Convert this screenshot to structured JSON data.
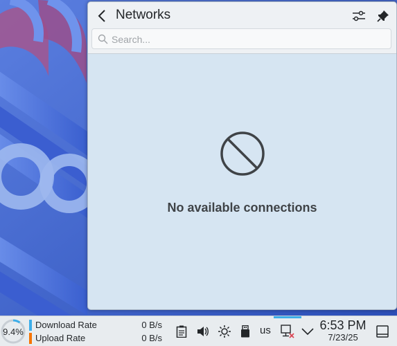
{
  "popup": {
    "title": "Networks",
    "search_placeholder": "Search...",
    "empty_message": "No available connections"
  },
  "taskbar": {
    "cpu_load": "9.4%",
    "download_label": "Download Rate",
    "download_value": "0 B/s",
    "upload_label": "Upload Rate",
    "upload_value": "0 B/s",
    "keyboard_layout": "us",
    "clock_time": "6:53 PM",
    "clock_date": "7/23/25"
  },
  "colors": {
    "download_bar": "#3daee9",
    "upload_bar": "#f67400",
    "accent": "#3daee9"
  },
  "icons": {
    "back": "chevron-left-icon",
    "settings": "sliders-icon",
    "pin": "pin-icon",
    "search": "search-icon",
    "empty": "no-entry-icon",
    "clipboard": "clipboard-icon",
    "volume": "speaker-icon",
    "brightness": "sun-icon",
    "usb": "usb-device-icon",
    "network": "network-disconnected-icon",
    "expand": "chevron-down-icon",
    "show_desktop": "show-desktop-icon"
  }
}
